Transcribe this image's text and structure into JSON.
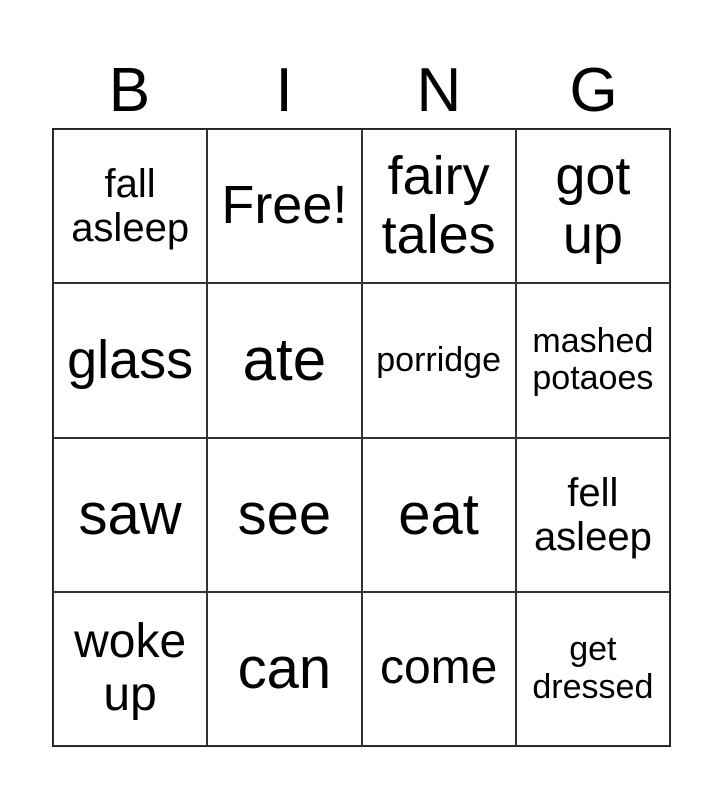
{
  "header": [
    "B",
    "I",
    "N",
    "G"
  ],
  "cells": [
    {
      "text": "fall asleep",
      "size": 40
    },
    {
      "text": "Free!",
      "size": 54
    },
    {
      "text": "fairy tales",
      "size": 54
    },
    {
      "text": "got up",
      "size": 54
    },
    {
      "text": "glass",
      "size": 54
    },
    {
      "text": "ate",
      "size": 60
    },
    {
      "text": "porridge",
      "size": 34
    },
    {
      "text": "mashed potaoes",
      "size": 34
    },
    {
      "text": "saw",
      "size": 58
    },
    {
      "text": "see",
      "size": 58
    },
    {
      "text": "eat",
      "size": 58
    },
    {
      "text": "fell asleep",
      "size": 40
    },
    {
      "text": "woke up",
      "size": 48
    },
    {
      "text": "can",
      "size": 58
    },
    {
      "text": "come",
      "size": 48
    },
    {
      "text": "get dressed",
      "size": 34
    }
  ]
}
